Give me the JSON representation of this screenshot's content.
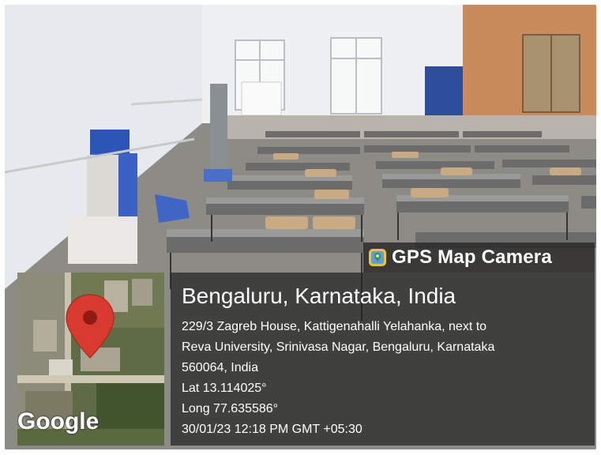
{
  "overlay": {
    "app_name": "GPS Map Camera",
    "location_title": "Bengaluru, Karnataka, India",
    "address_lines": [
      "229/3 Zagreb House, Kattigenahalli Yelahanka, next to",
      "Reva University, Srinivasa Nagar, Bengaluru, Karnataka",
      "560064, India"
    ],
    "latitude": "Lat 13.114025°",
    "longitude": "Long 77.635586°",
    "timestamp": "30/01/23 12:18 PM GMT +05:30"
  },
  "map": {
    "provider_logo": "Google",
    "marker_icon": "map-pin-icon",
    "marker_color": "#d93a2f"
  },
  "scene": {
    "description_icon": "classroom-photo"
  }
}
